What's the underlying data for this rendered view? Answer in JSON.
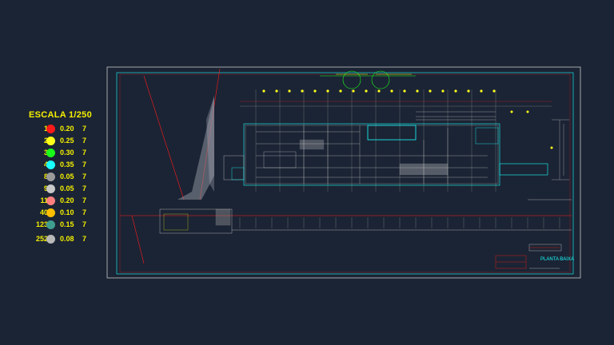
{
  "legend": {
    "title": "ESCALA 1/250",
    "rows": [
      {
        "index": "1",
        "color": "#ff1a1a",
        "lineweight": "0.20",
        "value": "7"
      },
      {
        "index": "2",
        "color": "#ffff1a",
        "lineweight": "0.25",
        "value": "7"
      },
      {
        "index": "3",
        "color": "#1aff1a",
        "lineweight": "0.30",
        "value": "7"
      },
      {
        "index": "4",
        "color": "#1affff",
        "lineweight": "0.35",
        "value": "7"
      },
      {
        "index": "8",
        "color": "#9a9a9a",
        "lineweight": "0.05",
        "value": "7"
      },
      {
        "index": "9",
        "color": "#c8c8c8",
        "lineweight": "0.05",
        "value": "7"
      },
      {
        "index": "11",
        "color": "#ff7f7f",
        "lineweight": "0.20",
        "value": "7"
      },
      {
        "index": "40",
        "color": "#ffbf00",
        "lineweight": "0.10",
        "value": "7"
      },
      {
        "index": "123",
        "color": "#3f9f8f",
        "lineweight": "0.15",
        "value": "7"
      },
      {
        "index": "252",
        "color": "#b8b8b8",
        "lineweight": "0.08",
        "value": "7"
      }
    ]
  },
  "drawing": {
    "sheet_label": "PLANTA BAIXA",
    "colors": {
      "background": "#1b2434",
      "frame": "#c8c8c8",
      "cyan": "#1affff",
      "red": "#ff1a1a",
      "green": "#1aff1a",
      "yellow": "#ffff1a",
      "grey": "#9a9a9a"
    }
  }
}
